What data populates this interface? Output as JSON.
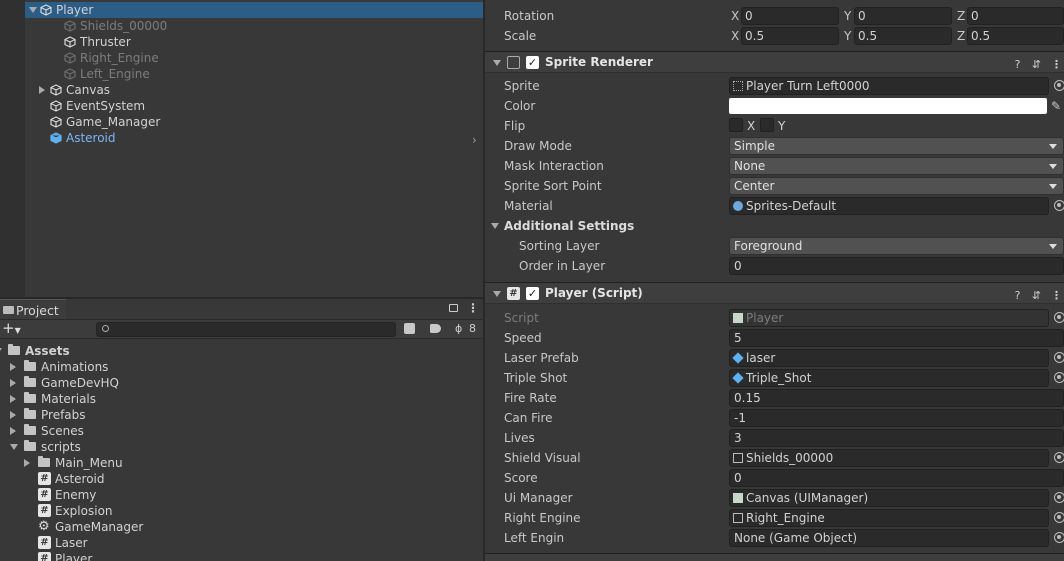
{
  "hierarchy": {
    "items": [
      {
        "label": "Player",
        "state": "selected"
      },
      {
        "label": "Shields_00000",
        "state": "disabled"
      },
      {
        "label": "Thruster",
        "state": "normal"
      },
      {
        "label": "Right_Engine",
        "state": "disabled"
      },
      {
        "label": "Left_Engine",
        "state": "disabled"
      },
      {
        "label": "Canvas",
        "state": "normal"
      },
      {
        "label": "EventSystem",
        "state": "normal"
      },
      {
        "label": "Game_Manager",
        "state": "normal"
      },
      {
        "label": "Asteroid",
        "state": "prefab"
      }
    ]
  },
  "project": {
    "tab_label": "Project",
    "hidden_count": "8",
    "tree": [
      {
        "label": "Assets",
        "type": "root"
      },
      {
        "label": "Animations",
        "type": "folder"
      },
      {
        "label": "GameDevHQ",
        "type": "folder"
      },
      {
        "label": "Materials",
        "type": "folder"
      },
      {
        "label": "Prefabs",
        "type": "folder"
      },
      {
        "label": "Scenes",
        "type": "folder"
      },
      {
        "label": "scripts",
        "type": "folder-open"
      },
      {
        "label": "Main_Menu",
        "type": "folder"
      },
      {
        "label": "Asteroid",
        "type": "script"
      },
      {
        "label": "Enemy",
        "type": "script"
      },
      {
        "label": "Explosion",
        "type": "script"
      },
      {
        "label": "GameManager",
        "type": "gear"
      },
      {
        "label": "Laser",
        "type": "script"
      },
      {
        "label": "Player",
        "type": "script"
      }
    ]
  },
  "inspector": {
    "transform": {
      "rotation_label": "Rotation",
      "rotation": {
        "x": "0",
        "y": "0",
        "z": "0"
      },
      "scale_label": "Scale",
      "scale": {
        "x": "0.5",
        "y": "0.5",
        "z": "0.5"
      },
      "axis": {
        "x": "X",
        "y": "Y",
        "z": "Z"
      }
    },
    "sprite_renderer": {
      "title": "Sprite Renderer",
      "sprite_label": "Sprite",
      "sprite": "Player Turn Left0000",
      "color_label": "Color",
      "color": "#ffffff",
      "flip_label": "Flip",
      "flip_x": "X",
      "flip_y": "Y",
      "draw_mode_label": "Draw Mode",
      "draw_mode": "Simple",
      "mask_label": "Mask Interaction",
      "mask": "None",
      "sort_point_label": "Sprite Sort Point",
      "sort_point": "Center",
      "material_label": "Material",
      "material": "Sprites-Default",
      "additional_label": "Additional Settings",
      "sorting_layer_label": "Sorting Layer",
      "sorting_layer": "Foreground",
      "order_label": "Order in Layer",
      "order": "0"
    },
    "player_script": {
      "title": "Player (Script)",
      "fields": [
        {
          "label": "Script",
          "value": "Player",
          "kind": "script-ref"
        },
        {
          "label": "Speed",
          "value": "5",
          "kind": "text"
        },
        {
          "label": "Laser Prefab",
          "value": "laser",
          "kind": "prefab-ref"
        },
        {
          "label": "Triple Shot",
          "value": "Triple_Shot",
          "kind": "prefab-ref"
        },
        {
          "label": "Fire Rate",
          "value": "0.15",
          "kind": "text"
        },
        {
          "label": "Can Fire",
          "value": "-1",
          "kind": "text"
        },
        {
          "label": "Lives",
          "value": "3",
          "kind": "text"
        },
        {
          "label": "Shield Visual",
          "value": "Shields_00000",
          "kind": "go-ref"
        },
        {
          "label": "Score",
          "value": "0",
          "kind": "text"
        },
        {
          "label": "Ui Manager",
          "value": "Canvas (UIManager)",
          "kind": "script-ref"
        },
        {
          "label": "Right Engine",
          "value": "Right_Engine",
          "kind": "go-ref"
        },
        {
          "label": "Left Engin",
          "value": "None (Game Object)",
          "kind": "none-ref"
        }
      ]
    }
  },
  "colors": {
    "selection": "#2c5d87",
    "prefab": "#7cb5f5",
    "panel": "#383838"
  }
}
